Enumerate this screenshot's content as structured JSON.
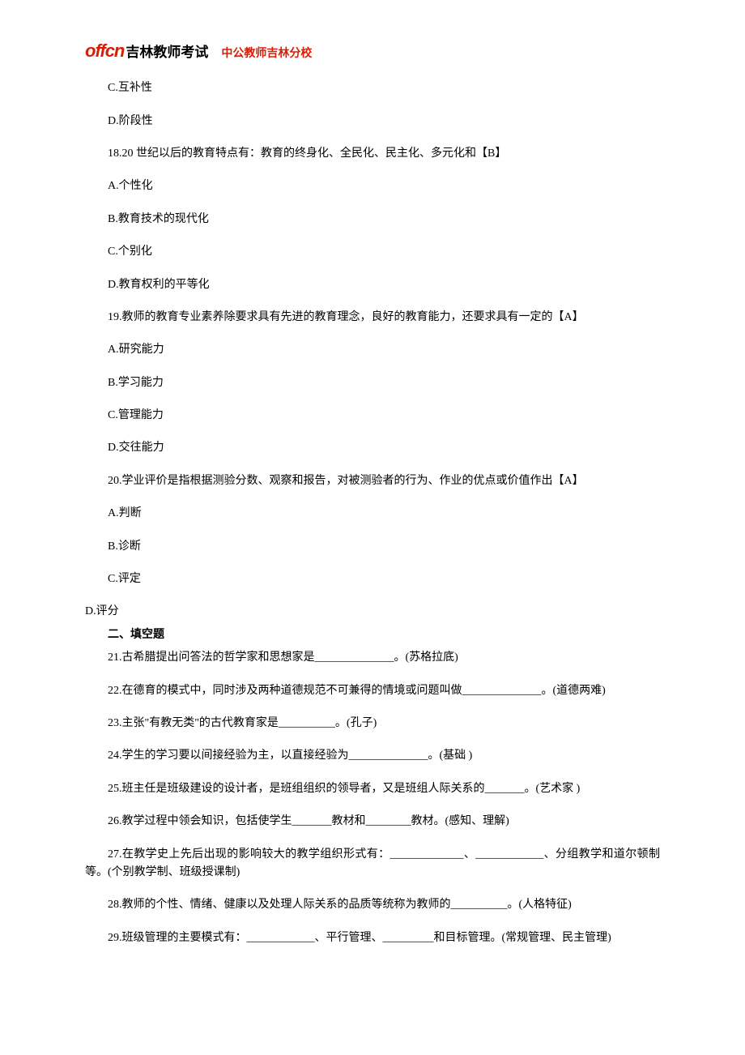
{
  "header": {
    "logo_offcn": "offcn",
    "logo_chinese": "吉林教师考试",
    "subtitle": "中公教师吉林分校"
  },
  "lines": [
    {
      "text": "C.互补性",
      "cls": "para indent"
    },
    {
      "text": "D.阶段性",
      "cls": "para indent"
    },
    {
      "text": "18.20 世纪以后的教育特点有：教育的终身化、全民化、民主化、多元化和【B】",
      "cls": "para indent"
    },
    {
      "text": "A.个性化",
      "cls": "para indent"
    },
    {
      "text": "B.教育技术的现代化",
      "cls": "para indent"
    },
    {
      "text": "C.个别化",
      "cls": "para indent"
    },
    {
      "text": "D.教育权利的平等化",
      "cls": "para indent"
    },
    {
      "text": "19.教师的教育专业素养除要求具有先进的教育理念，良好的教育能力，还要求具有一定的【A】",
      "cls": "para indent"
    },
    {
      "text": "A.研究能力",
      "cls": "para indent"
    },
    {
      "text": "B.学习能力",
      "cls": "para indent"
    },
    {
      "text": "C.管理能力",
      "cls": "para indent"
    },
    {
      "text": "D.交往能力",
      "cls": "para indent"
    },
    {
      "text": "20.学业评价是指根据测验分数、观察和报告，对被测验者的行为、作业的优点或价值作出【A】",
      "cls": "para indent"
    },
    {
      "text": "A.判断",
      "cls": "para indent"
    },
    {
      "text": "B.诊断",
      "cls": "para indent"
    },
    {
      "text": "C.评定",
      "cls": "para indent"
    },
    {
      "text": "D.评分",
      "cls": "para no-indent tight"
    },
    {
      "text": "二、填空题",
      "cls": "section-title tight"
    },
    {
      "text": "21.古希腊提出问答法的哲学家和思想家是______________。(苏格拉底)",
      "cls": "para indent"
    },
    {
      "text": "22.在德育的模式中，同时涉及两种道德规范不可兼得的情境或问题叫做______________。(道德两难)",
      "cls": "para indent"
    },
    {
      "text": "23.主张\"有教无类\"的古代教育家是__________。(孔子)",
      "cls": "para indent"
    },
    {
      "text": "24.学生的学习要以间接经验为主，以直接经验为______________。(基础 )",
      "cls": "para indent"
    },
    {
      "text": "25.班主任是班级建设的设计者，是班组组织的领导者，又是班组人际关系的_______。(艺术家 )",
      "cls": "para indent"
    },
    {
      "text": "26.教学过程中领会知识，包括使学生_______教材和________教材。(感知、理解)",
      "cls": "para indent"
    },
    {
      "text": "27.在教学史上先后出现的影响较大的教学组织形式有：_____________、____________、分组教学和道尔顿制等。(个别教学制、班级授课制)",
      "cls": "para indent"
    },
    {
      "text": "28.教师的个性、情绪、健康以及处理人际关系的品质等统称为教师的__________。(人格特征)",
      "cls": "para indent"
    },
    {
      "text": "29.班级管理的主要模式有：____________、平行管理、_________和目标管理。(常规管理、民主管理)",
      "cls": "para indent"
    }
  ]
}
